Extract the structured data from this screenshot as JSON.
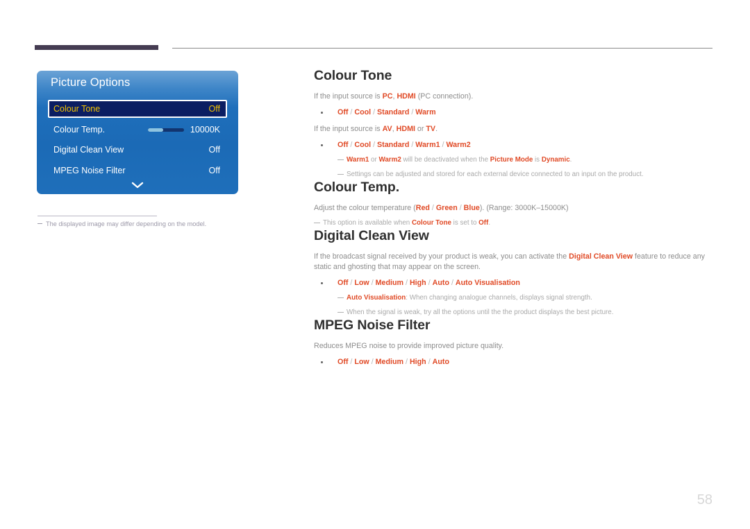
{
  "page": {
    "number": "58",
    "accent_color": "#e04a26",
    "heading_color": "#2f2f2f",
    "body_color": "#8c8c8c",
    "osd_highlight_text": "#f2c200"
  },
  "osd": {
    "title": "Picture Options",
    "rows": [
      {
        "label": "Colour Tone",
        "value": "Off",
        "selected": true
      },
      {
        "label": "Colour Temp.",
        "value": "10000K",
        "selected": false,
        "slider_percent": 43
      },
      {
        "label": "Digital Clean View",
        "value": "Off",
        "selected": false
      },
      {
        "label": "MPEG Noise Filter",
        "value": "Off",
        "selected": false
      }
    ],
    "scroll_icon": "chevron-down-icon",
    "footnote": "The displayed image may differ depending on the model."
  },
  "sections": [
    {
      "heading": "Colour Tone",
      "intro": {
        "lead": "If the input source is ",
        "opt1": "PC",
        "mid": ", ",
        "opt2": "HDMI",
        "tail": " (PC connection)."
      },
      "bullet": "Off / Cool / Standard / Warm",
      "intro2": {
        "lead": "If the input source is ",
        "opt1": "AV",
        "mid": ", ",
        "opt2": "HDMI",
        "mid2": " or ",
        "opt3": "TV",
        "tail": "."
      },
      "bullet2": "Off / Cool / Standard / Warm1 / Warm2",
      "notes": [
        {
          "a": "Warm1",
          "b": " or ",
          "c": "Warm2",
          "d": " will be deactivated when the ",
          "e": "Picture Mode",
          "f": " is ",
          "g": "Dynamic",
          "h": "."
        },
        {
          "plain": "Settings can be adjusted and stored for each external device connected to an input on the product."
        }
      ]
    },
    {
      "heading": "Colour Temp.",
      "intro": {
        "lead": "Adjust the colour temperature (",
        "opt1": "Red",
        "s1": " / ",
        "opt2": "Green",
        "s2": " / ",
        "opt3": "Blue",
        "tail": "). (Range: 3000K–15000K)"
      },
      "note": {
        "lead": "This option is available when ",
        "opt1": "Colour Tone",
        "mid": " is set to ",
        "opt2": "Off",
        "tail": "."
      }
    },
    {
      "heading": "Digital Clean View",
      "paragraph": {
        "p1": "If the broadcast signal received by your product is weak, you can activate the ",
        "opt1": "Digital Clean View",
        "p2": " feature to reduce any static and ghosting that may appear on the screen."
      },
      "bullet": "Off / Low / Medium / High / Auto / Auto Visualisation",
      "notes": [
        {
          "a": "Auto Visualisation",
          "rest": ": When changing analogue channels, displays signal strength."
        },
        {
          "plain": "When the signal is weak, try all the options until the the product displays the best picture."
        }
      ]
    },
    {
      "heading": "MPEG Noise Filter",
      "intro_plain": "Reduces MPEG noise to provide improved picture quality.",
      "bullet": "Off / Low / Medium / High / Auto"
    }
  ]
}
